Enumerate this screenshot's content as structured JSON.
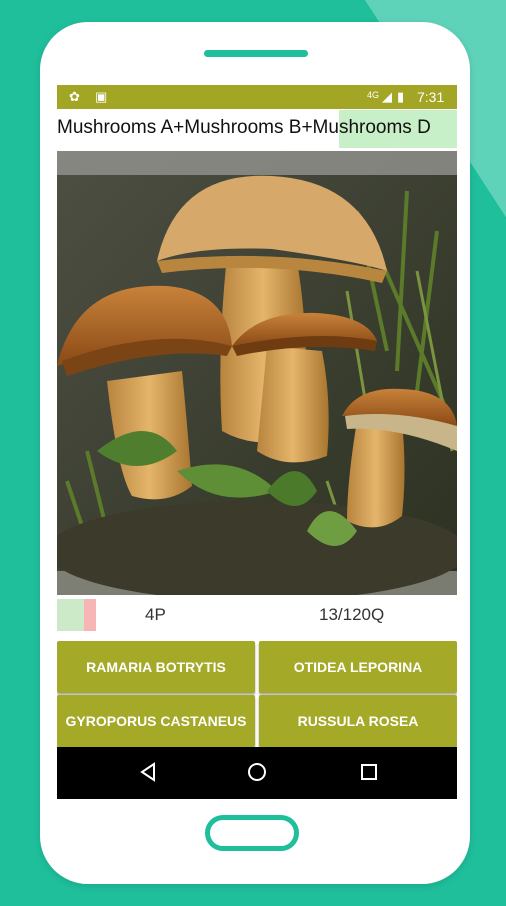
{
  "statusbar": {
    "left_icons": [
      "settings-icon",
      "image-icon"
    ],
    "signal": "4G",
    "time": "7:31",
    "color": "#a2a624"
  },
  "title": "Mushrooms A+Mushrooms B+Mushrooms D",
  "quiz": {
    "score": "4P",
    "progress": "13/120Q"
  },
  "answers": [
    {
      "label": "RAMARIA BOTRYTIS"
    },
    {
      "label": "OTIDEA LEPORINA"
    },
    {
      "label": "GYROPORUS CASTANEUS"
    },
    {
      "label": "RUSSULA ROSEA"
    }
  ],
  "navbar": {
    "icons": [
      "back-icon",
      "home-icon",
      "recents-icon"
    ]
  },
  "colors": {
    "accent": "#a5a928",
    "background": "#1fbf9c"
  }
}
